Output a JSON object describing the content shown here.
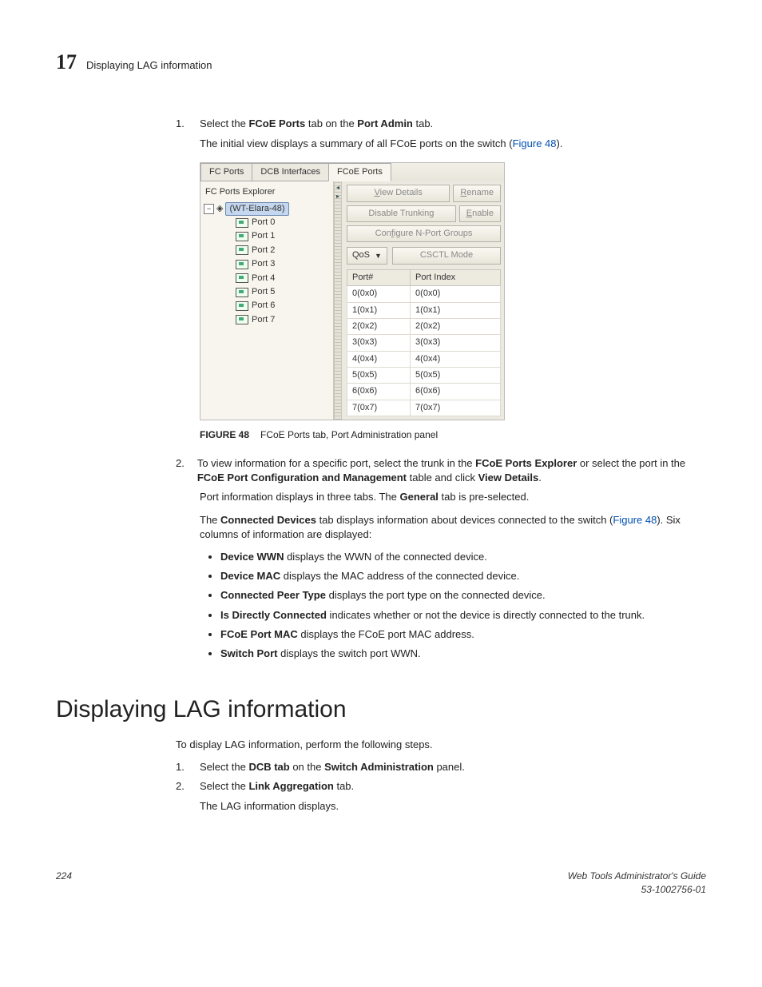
{
  "header": {
    "chapter_number": "17",
    "running_title": "Displaying LAG information"
  },
  "step1": {
    "num": "1.",
    "text_a": "Select the ",
    "bold_a": "FCoE Ports",
    "text_b": " tab on the ",
    "bold_b": "Port Admin",
    "text_c": " tab."
  },
  "step1_para": {
    "text_a": "The initial view displays a summary of all FCoE ports on the switch (",
    "link": "Figure 48",
    "text_b": ")."
  },
  "screenshot": {
    "tabs": {
      "fc": "FC Ports",
      "dcb": "DCB Interfaces",
      "fcoe": "FCoE Ports"
    },
    "explorer_title": "FC Ports Explorer",
    "root_name": "(WT-Elara-48)",
    "ports": [
      "Port 0",
      "Port 1",
      "Port 2",
      "Port 3",
      "Port 4",
      "Port 5",
      "Port 6",
      "Port 7"
    ],
    "buttons": {
      "view_details": "View Details",
      "rename": "Rename",
      "disable_trunking": "Disable Trunking",
      "enable": "Enable",
      "configure_nport": "Configure N-Port Groups",
      "qos": "QoS",
      "csctl": "CSCTL Mode"
    },
    "table": {
      "headers": [
        "Port#",
        "Port Index"
      ],
      "rows": [
        [
          "0(0x0)",
          "0(0x0)"
        ],
        [
          "1(0x1)",
          "1(0x1)"
        ],
        [
          "2(0x2)",
          "2(0x2)"
        ],
        [
          "3(0x3)",
          "3(0x3)"
        ],
        [
          "4(0x4)",
          "4(0x4)"
        ],
        [
          "5(0x5)",
          "5(0x5)"
        ],
        [
          "6(0x6)",
          "6(0x6)"
        ],
        [
          "7(0x7)",
          "7(0x7)"
        ]
      ]
    }
  },
  "fig_caption": {
    "label": "FIGURE 48",
    "text": "FCoE Ports tab, Port Administration panel"
  },
  "step2": {
    "num": "2.",
    "t1": "To view information for a specific port, select the trunk in the ",
    "b1": "FCoE Ports Explorer",
    "t2": " or select the port in the ",
    "b2": "FCoE Port Configuration and Management",
    "t3": " table and click ",
    "b3": "View Details",
    "t4": "."
  },
  "step2_p2": {
    "t1": "Port information displays in three tabs. The ",
    "b1": "General",
    "t2": " tab is pre-selected."
  },
  "step2_p3": {
    "t1": "The ",
    "b1": "Connected Devices",
    "t2": " tab displays information about devices connected to the switch (",
    "link": "Figure 48",
    "t3": "). Six columns of information are displayed:"
  },
  "bullets": [
    {
      "b": "Device WWN",
      "t": " displays the WWN of the connected device."
    },
    {
      "b": "Device MAC",
      "t": " displays the MAC address of the connected device."
    },
    {
      "b": "Connected Peer Type",
      "t": " displays the port type on the connected device."
    },
    {
      "b": "Is Directly Connected",
      "t": " indicates whether or not the device is directly connected to the trunk."
    },
    {
      "b": "FCoE Port MAC",
      "t": " displays the FCoE port MAC address."
    },
    {
      "b": "Switch Port",
      "t": " displays the switch port WWN."
    }
  ],
  "section_heading": "Displaying LAG information",
  "lag_intro": "To display LAG information, perform the following steps.",
  "lag_steps": [
    {
      "num": "1.",
      "t1": "Select the ",
      "b1": "DCB tab",
      "t2": " on the ",
      "b2": "Switch Administration",
      "t3": " panel."
    },
    {
      "num": "2.",
      "t1": "Select the ",
      "b1": "Link Aggregation",
      "t2": " tab.",
      "b2": "",
      "t3": ""
    }
  ],
  "lag_after": "The LAG information displays.",
  "footer": {
    "page": "224",
    "guide": "Web Tools Administrator's Guide",
    "docnum": "53-1002756-01"
  }
}
